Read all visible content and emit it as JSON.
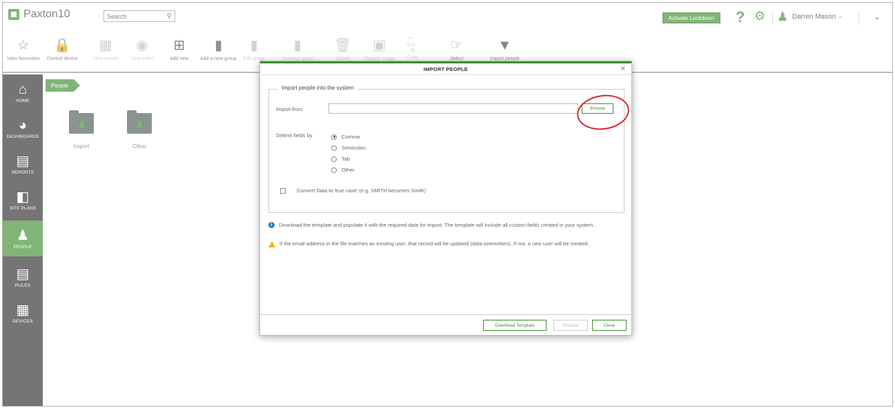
{
  "app": {
    "title": "Paxton10"
  },
  "search": {
    "placeholder": "Search"
  },
  "header": {
    "lockdown_label": "Activate Lockdown",
    "user_name": "Darren Mason"
  },
  "toolbar": {
    "items": [
      {
        "label": "View favourites",
        "icon": "star-icon",
        "enabled": true
      },
      {
        "label": "Control device",
        "icon": "lock-icon",
        "enabled": true
      },
      {
        "label": "View events",
        "icon": "calendar-icon",
        "enabled": false
      },
      {
        "label": "View video",
        "icon": "camera-icon",
        "enabled": false
      },
      {
        "label": "Add new",
        "icon": "add-grid-icon",
        "enabled": true
      },
      {
        "label": "Add a new group",
        "icon": "folder-add-icon",
        "enabled": true
      },
      {
        "label": "Edit group",
        "icon": "folder-edit-icon",
        "enabled": false
      },
      {
        "label": "Rename group",
        "icon": "folder-rename-icon",
        "enabled": false
      },
      {
        "label": "Delete",
        "icon": "trash-icon",
        "enabled": false
      },
      {
        "label": "Change image",
        "icon": "image-icon",
        "enabled": false
      },
      {
        "label": "Cut",
        "icon": "cut-icon",
        "enabled": false
      },
      {
        "label": "Copy",
        "icon": "copy-icon",
        "enabled": false
      },
      {
        "label": "Select",
        "icon": "select-icon",
        "enabled": true
      },
      {
        "label": "Import people",
        "icon": "import-icon",
        "enabled": true
      }
    ]
  },
  "sidebar": {
    "items": [
      {
        "label": "HOME",
        "icon": "home-icon"
      },
      {
        "label": "DASHBOARDS",
        "icon": "dashboard-icon"
      },
      {
        "label": "REPORTS",
        "icon": "reports-icon"
      },
      {
        "label": "SITE PLANS",
        "icon": "site-plans-icon"
      },
      {
        "label": "PEOPLE",
        "icon": "people-icon",
        "active": true
      },
      {
        "label": "RULES",
        "icon": "rules-icon"
      },
      {
        "label": "DEVICES",
        "icon": "devices-icon"
      }
    ]
  },
  "breadcrumb": {
    "label": "People"
  },
  "folders": [
    {
      "label": "Import"
    },
    {
      "label": "Other"
    }
  ],
  "modal": {
    "title": "IMPORT PEOPLE",
    "section_title": "Import people into the system",
    "import_from_label": "Import from",
    "import_from_value": "",
    "browse_label": "Browse",
    "delimit_label": "Delimit fields by",
    "delimit_options": [
      "Comma",
      "Semicolon",
      "Tab",
      "Other"
    ],
    "delimit_selected": "Comma",
    "true_case_label": "Convert Data to 'true case' (e.g. SMITH becomes Smith)",
    "true_case_checked": false,
    "info_text": "Download the template and populate it with the required data for import. The template will include all custom fields created in your system.",
    "warning_text": "If the email address in the file matches an existing user, that record will be updated (data overwritten). If not, a new user will be created.",
    "download_template_label": "Download Template",
    "preview_label": "Preview",
    "close_label": "Close"
  },
  "colors": {
    "brand_green": "#3e8e2e",
    "sidebar_bg": "#2b2b2b",
    "highlight_red": "#d9242b",
    "info_blue": "#1e7fd0",
    "warning_yellow": "#f0b400"
  }
}
